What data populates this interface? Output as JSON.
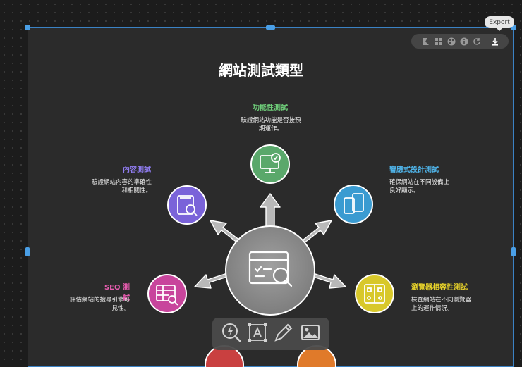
{
  "title": "網站測試類型",
  "export_label": "Export",
  "items": {
    "functional": {
      "label": "功能性測試",
      "desc1": "驗證網站功能是否按預",
      "desc2": "期運作。",
      "color": "#6fcf7a"
    },
    "responsive": {
      "label": "響應式設計測試",
      "desc1": "確保網站在不同設備上",
      "desc2": "良好顯示。",
      "color": "#4fb3e8"
    },
    "content": {
      "label": "內容測試",
      "desc1": "驗證網站內容的準確性",
      "desc2": "和相關性。",
      "color": "#8f7cf0"
    },
    "browser": {
      "label": "瀏覽器相容性測試",
      "desc1": "檢查網站在不同瀏覽器",
      "desc2": "上的運作情況。",
      "color": "#e8d22a"
    },
    "seo": {
      "label": "SEO 測試",
      "desc1": "評估網站的搜尋引擎可",
      "desc2": "見性。",
      "color": "#e85db0"
    }
  },
  "toolbar_icons": [
    "layout-icon",
    "grid-icon",
    "palette-icon",
    "info-icon",
    "refresh-icon",
    "download-icon"
  ],
  "bottom_tools": [
    "magic-zoom-icon",
    "text-icon",
    "pen-icon",
    "image-icon"
  ]
}
